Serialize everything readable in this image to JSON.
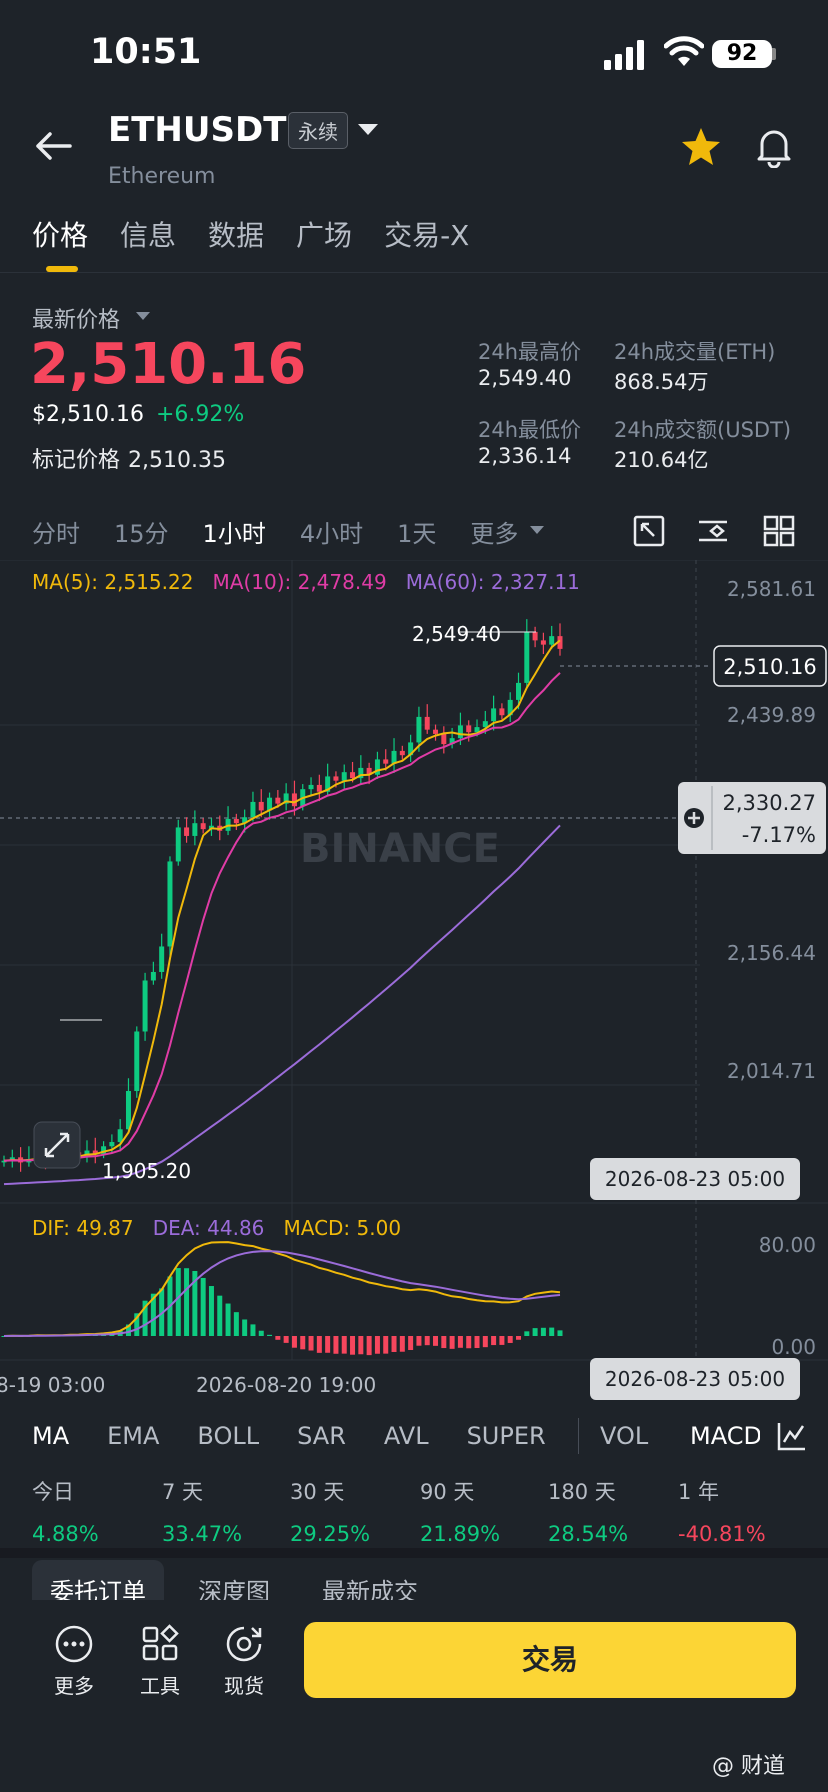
{
  "status_bar": {
    "time": "10:51",
    "battery": "92"
  },
  "header": {
    "symbol": "ETHUSDT",
    "contract_badge": "永续",
    "subtitle": "Ethereum"
  },
  "tabs": [
    "价格",
    "信息",
    "数据",
    "广场",
    "交易-X"
  ],
  "price_panel": {
    "label": "最新价格",
    "last_price": "2,510.16",
    "usd_price": "$2,510.16",
    "change": "+6.92%",
    "mark_label": "标记价格",
    "mark_price": "2,510.35",
    "stats": [
      {
        "label": "24h最高价",
        "value": "2,549.40"
      },
      {
        "label": "24h成交量(ETH)",
        "value": "868.54万"
      },
      {
        "label": "24h最低价",
        "value": "2,336.14"
      },
      {
        "label": "24h成交额(USDT)",
        "value": "210.64亿"
      }
    ]
  },
  "timeframes": {
    "items": [
      "分时",
      "15分",
      "1小时",
      "4小时",
      "1天",
      "更多"
    ],
    "active": "1小时"
  },
  "chart_data": {
    "type": "candlestick",
    "ma_legend": {
      "ma5": "MA(5): 2,515.22",
      "ma10": "MA(10): 2,478.49",
      "ma60": "MA(60): 2,327.11"
    },
    "y_ticks": [
      "2,581.61",
      "2,439.89",
      "2,156.44",
      "2,014.71"
    ],
    "current_price_tag": "2,510.16",
    "crosshair_price": "2,330.27",
    "crosshair_pct": "-7.17%",
    "high_label": "2,549.40",
    "low_label": "1,905.20",
    "crosshair_date": "2026-08-23 05:00",
    "watermark": "BINANCE",
    "macd_legend": {
      "dif": "DIF: 49.87",
      "dea": "DEA: 44.86",
      "macd": "MACD: 5.00"
    },
    "macd_ticks": [
      "80.00",
      "0.00"
    ],
    "x_labels": [
      "8-19 03:00",
      "2026-08-20 19:00"
    ],
    "colors": {
      "up": "#0ecb81",
      "down": "#f6465d",
      "ma5": "#f0b90b",
      "ma10": "#e03ca6",
      "ma60": "#9b6cd9"
    },
    "closes": [
      1908,
      1912,
      1906,
      1910,
      1915,
      1909,
      1913,
      1911,
      1918,
      1914,
      1920,
      1916,
      1925,
      1930,
      1945,
      1990,
      2060,
      2120,
      2130,
      2160,
      2260,
      2300,
      2290,
      2305,
      2298,
      2302,
      2296,
      2310,
      2305,
      2312,
      2330,
      2320,
      2335,
      2328,
      2340,
      2325,
      2345,
      2350,
      2342,
      2360,
      2355,
      2365,
      2358,
      2370,
      2362,
      2380,
      2375,
      2390,
      2385,
      2400,
      2430,
      2415,
      2410,
      2398,
      2405,
      2420,
      2412,
      2418,
      2425,
      2440,
      2432,
      2450,
      2470,
      2530,
      2520,
      2515,
      2525,
      2510
    ]
  },
  "indicator_tabs": {
    "items": [
      "MA",
      "EMA",
      "BOLL",
      "SAR",
      "AVL",
      "SUPER",
      "VOL",
      "MACD"
    ],
    "active": [
      "MA",
      "MACD"
    ]
  },
  "performance": [
    {
      "label": "今日",
      "value": "4.88%",
      "dir": "pos"
    },
    {
      "label": "7 天",
      "value": "33.47%",
      "dir": "pos"
    },
    {
      "label": "30 天",
      "value": "29.25%",
      "dir": "pos"
    },
    {
      "label": "90 天",
      "value": "21.89%",
      "dir": "pos"
    },
    {
      "label": "180 天",
      "value": "28.54%",
      "dir": "pos"
    },
    {
      "label": "1 年",
      "value": "-40.81%",
      "dir": "neg"
    }
  ],
  "order_tabs": [
    "委托订单",
    "深度图",
    "最新成交"
  ],
  "bottom_bar": {
    "more": "更多",
    "tools": "工具",
    "spot": "现货",
    "trade": "交易"
  },
  "watermark": "@ 财道"
}
